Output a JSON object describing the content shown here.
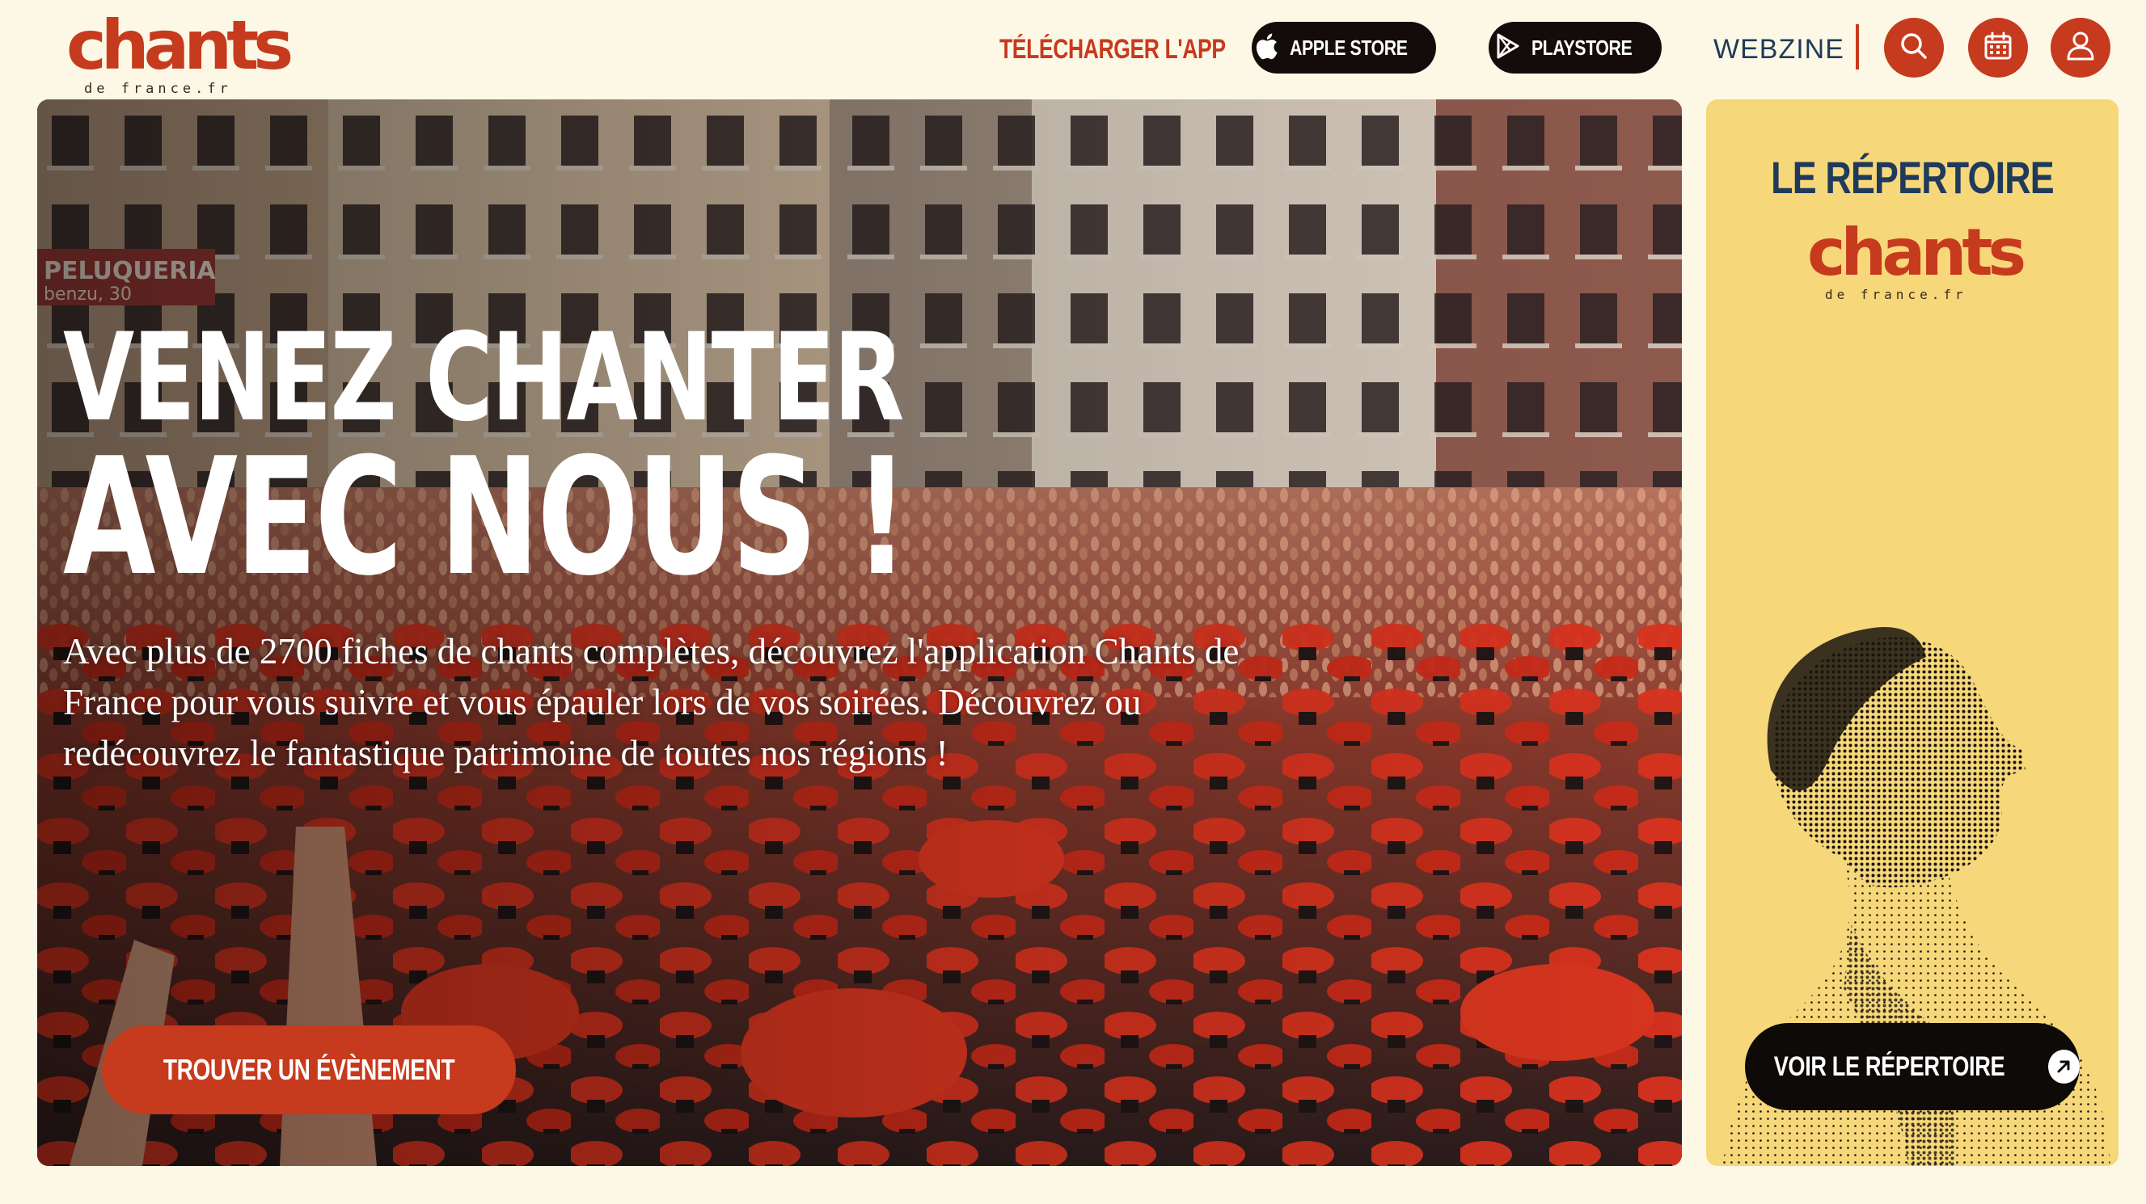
{
  "header": {
    "logo": {
      "word": "chants",
      "sub": "de france.fr"
    },
    "download_label": "TÉLÉCHARGER L'APP",
    "apple_store_label": "APPLE STORE",
    "playstore_label": "PLAYSTORE",
    "webzine_label": "WEBZINE",
    "icons": [
      "search-icon",
      "calendar-icon",
      "user-icon"
    ]
  },
  "hero": {
    "title_line1": "VENEZ CHANTER",
    "title_line2": "AVEC NOUS !",
    "description": "Avec plus de 2700 fiches de chants complètes, découvrez l'application Chants de France pour vous suivre et vous épauler lors de vos soirées. Découvrez ou redécouvrez le fantastique patrimoine de toutes nos régions !",
    "cta_label": "TROUVER UN ÉVÈNEMENT"
  },
  "side": {
    "title": "LE RÉPERTOIRE",
    "logo": {
      "word": "chants",
      "sub": "de france.fr"
    },
    "cta_label": "VOIR  LE RÉPERTOIRE"
  },
  "colors": {
    "page_background": "#FDF8E6",
    "brand_red": "#C63A1E",
    "navy": "#1F3A5A",
    "dark": "#140C0A",
    "panel_yellow": "#F6D779"
  }
}
